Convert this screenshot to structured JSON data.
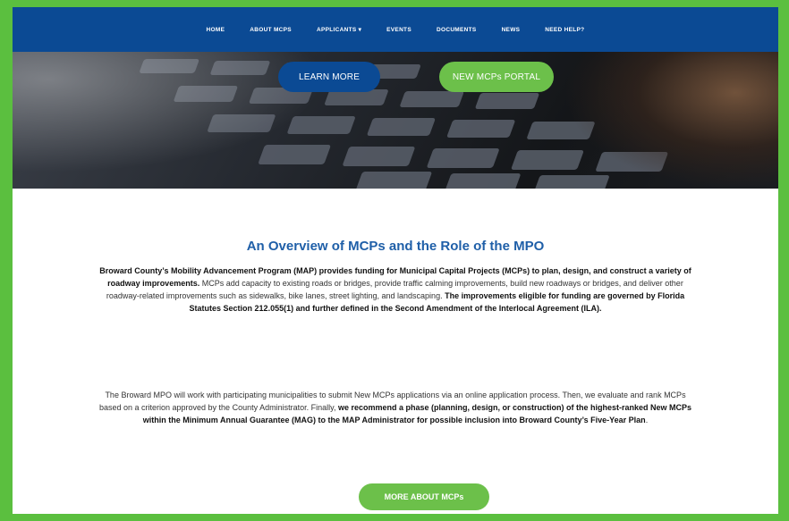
{
  "nav": {
    "items": [
      {
        "label": "HOME"
      },
      {
        "label": "ABOUT MCPS"
      },
      {
        "label": "APPLICANTS"
      },
      {
        "label": "EVENTS"
      },
      {
        "label": "DOCUMENTS"
      },
      {
        "label": "NEWS"
      },
      {
        "label": "NEED HELP?"
      }
    ]
  },
  "hero": {
    "learn_more_label": "LEARN MORE",
    "portal_label": "NEW MCPs PORTAL"
  },
  "overview": {
    "title": "An Overview of MCPs and the Role of the MPO",
    "p1_bold1": "Broward County’s Mobility Advancement Program (MAP) provides funding for Municipal Capital Projects (MCPs) to plan, design, and construct a variety of roadway improvements.",
    "p1_text": " MCPs add capacity to existing roads or bridges, provide traffic calming improvements, build new roadways or bridges, and deliver other roadway-related improvements such as sidewalks, bike lanes, street lighting, and landscaping. ",
    "p1_bold2": "The improvements eligible for funding are governed by Florida Statutes Section 212.055(1) and further defined in the Second Amendment of the Interlocal Agreement (ILA).",
    "p2_text": "The Broward MPO will work with participating municipalities to submit New MCPs applications via an online application process. Then, we evaluate and rank MCPs based on a criterion approved by the County Administrator. Finally, ",
    "p2_bold": "we recommend a phase (planning, design, or construction) of the highest-ranked New MCPs within the Minimum Annual Guarantee (MAG) to the MAP Administrator for possible inclusion into Broward County’s Five-Year Plan",
    "p2_end": ".",
    "more_label": "MORE ABOUT MCPs"
  },
  "colors": {
    "frame_green": "#5bbf3f",
    "nav_blue": "#0b4a94",
    "button_green": "#6cc04a",
    "title_blue": "#1f5fa8"
  }
}
